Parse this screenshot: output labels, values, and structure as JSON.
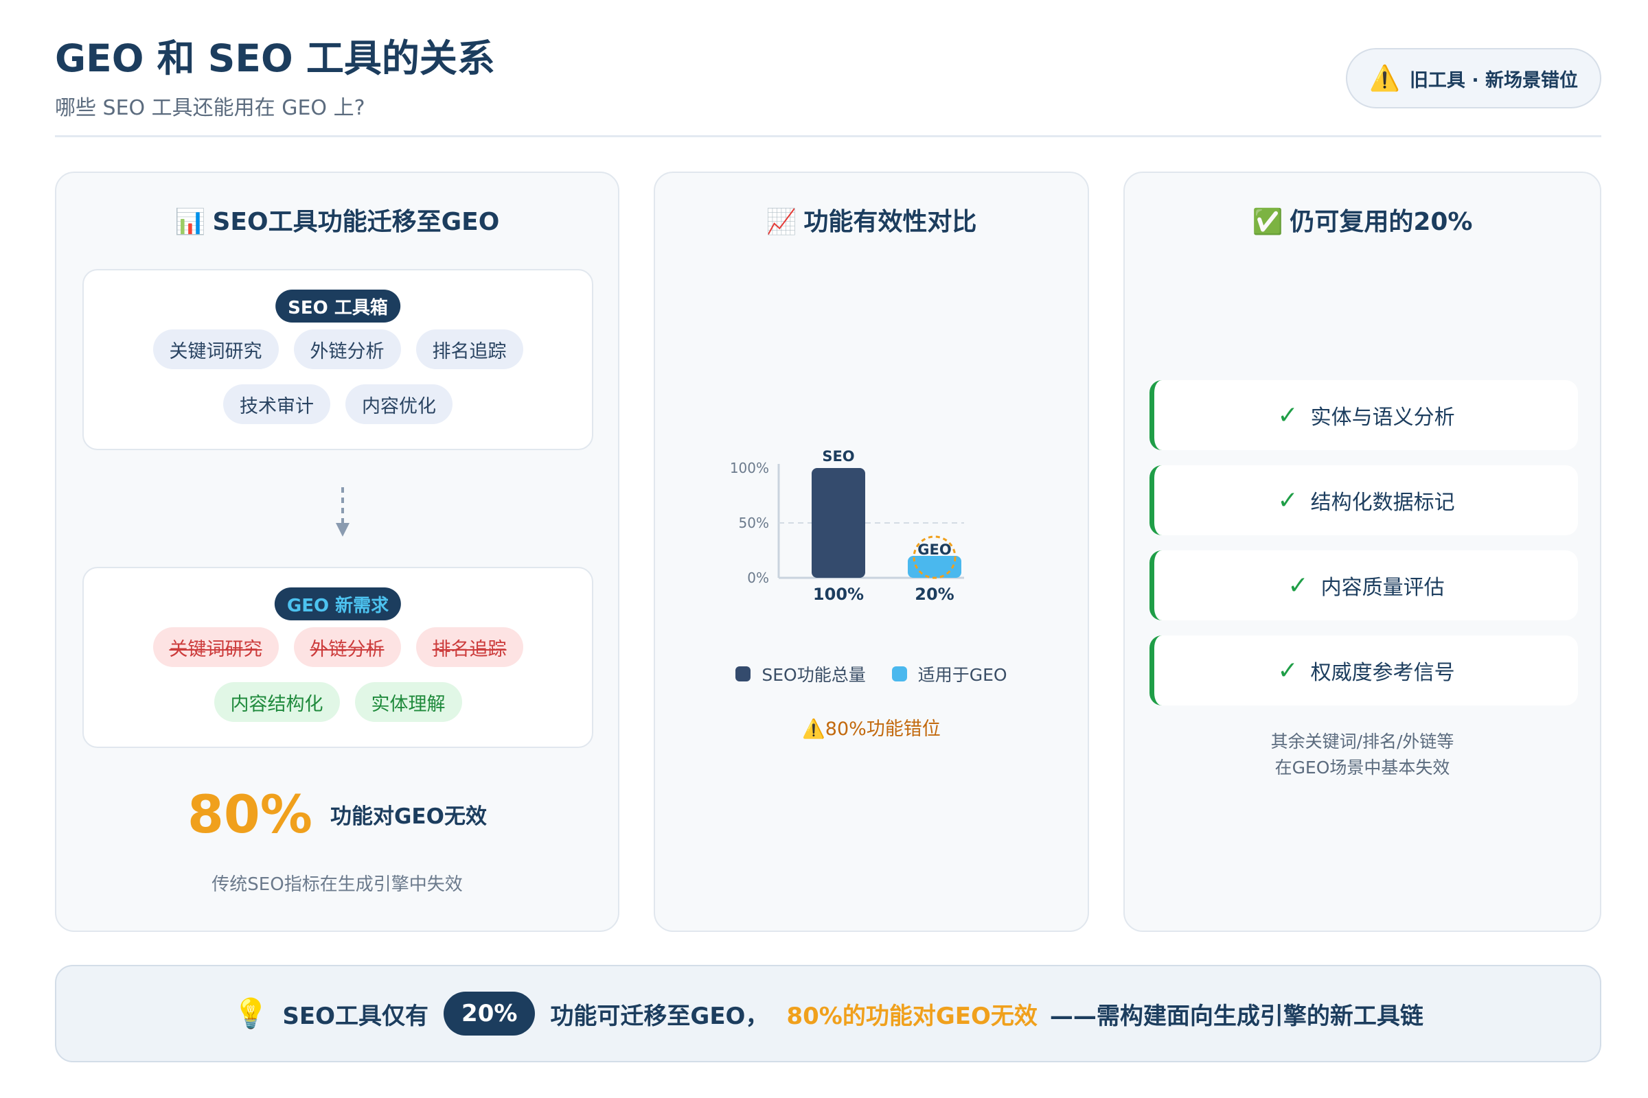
{
  "header": {
    "title": "GEO 和 SEO 工具的关系",
    "subtitle": "哪些 SEO 工具还能用在 GEO 上?",
    "badge_icon": "⚠️",
    "badge_text": "旧工具 · 新场景错位"
  },
  "panel1": {
    "icon": "📊",
    "title": "SEO工具功能迁移至GEO",
    "seo_box": {
      "tag": "SEO 工具箱",
      "chips_row1": [
        "关键词研究",
        "外链分析",
        "排名追踪"
      ],
      "chips_row2": [
        "技术审计",
        "内容优化"
      ]
    },
    "geo_box": {
      "tag": "GEO 新需求",
      "invalid_chips": [
        "关键词研究",
        "外链分析",
        "排名追踪"
      ],
      "new_chips": [
        "内容结构化",
        "实体理解"
      ]
    },
    "stat_value": "80%",
    "stat_label": "功能对GEO无效",
    "note": "传统SEO指标在生成引擎中失效"
  },
  "panel2": {
    "icon": "📈",
    "title": "功能有效性对比",
    "legend": [
      {
        "label": "SEO功能总量",
        "color": "#344b6d"
      },
      {
        "label": "适用于GEO",
        "color": "#4ab8ee"
      }
    ],
    "warning_icon": "⚠️",
    "warning_text": "80%功能错位"
  },
  "chart_data": {
    "type": "bar",
    "categories": [
      "SEO",
      "GEO"
    ],
    "values": [
      100,
      20
    ],
    "value_labels": [
      "100%",
      "20%"
    ],
    "colors": [
      "#344b6d",
      "#4ab8ee"
    ],
    "ylim": [
      0,
      100
    ],
    "yticks": [
      0,
      50,
      100
    ],
    "ytick_labels": [
      "0%",
      "50%",
      "100%"
    ],
    "gridline_at": 50
  },
  "panel3": {
    "icon": "✅",
    "title": "仍可复用的20%",
    "check_icon": "✓",
    "items": [
      "实体与语义分析",
      "结构化数据标记",
      "内容质量评估",
      "权威度参考信号"
    ],
    "note_line1": "其余关键词/排名/外链等",
    "note_line2": "在GEO场景中基本失效"
  },
  "banner": {
    "icon": "💡",
    "part1": "SEO工具仅有",
    "highlight": "20%",
    "part2": "功能可迁移至GEO，",
    "orange": "80%的功能对GEO无效",
    "part3": "——需构建面向生成引擎的新工具链"
  }
}
